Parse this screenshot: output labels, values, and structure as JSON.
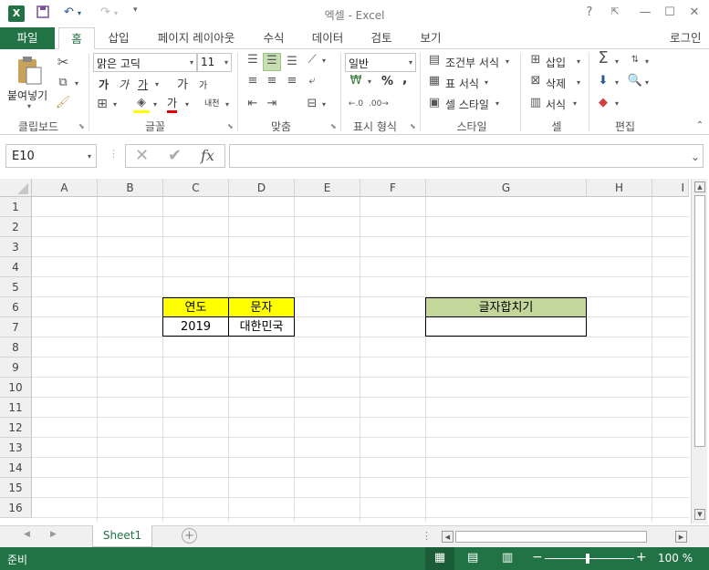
{
  "titlebar": {
    "title": "엑셀 - Excel",
    "app_icon": "excel-icon",
    "help": "?",
    "restore": "⊡",
    "minimize": "—",
    "maximize": "☐",
    "close": "✕"
  },
  "tabs": [
    {
      "label": "파일"
    },
    {
      "label": "홈"
    },
    {
      "label": "삽입"
    },
    {
      "label": "페이지 레이아웃"
    },
    {
      "label": "수식"
    },
    {
      "label": "데이터"
    },
    {
      "label": "검토"
    },
    {
      "label": "보기"
    }
  ],
  "signin": "로그인",
  "ribbon": {
    "clipboard": {
      "paste": "붙여넣기",
      "label": "클립보드"
    },
    "font": {
      "name": "맑은 고딕",
      "size": "11",
      "bold": "가",
      "italic": "가",
      "underline": "가",
      "grow": "가",
      "shrink": "가",
      "color_a": "가",
      "phonetic": "내천",
      "label": "글꼴"
    },
    "align": {
      "label": "맞춤"
    },
    "number": {
      "format": "일반",
      "percent": "%",
      "comma": ",",
      "label": "표시 형식"
    },
    "styles": {
      "conditional": "조건부 서식",
      "table": "표 서식",
      "cell": "셀 스타일",
      "label": "스타일"
    },
    "cells": {
      "insert": "삽입",
      "delete": "삭제",
      "format": "서식",
      "label": "셀"
    },
    "edit": {
      "label": "편집"
    }
  },
  "formula": {
    "namebox": "E10",
    "fx": "fx",
    "value": ""
  },
  "columns": [
    "A",
    "B",
    "C",
    "D",
    "E",
    "F",
    "G",
    "H",
    "I"
  ],
  "rows": [
    "1",
    "2",
    "3",
    "4",
    "5",
    "6",
    "7",
    "8",
    "9",
    "10",
    "11",
    "12",
    "13",
    "14",
    "15",
    "16"
  ],
  "cells": {
    "c6": "연도",
    "d6": "문자",
    "c7": "2019",
    "d7": "대한민국",
    "g6": "글자합치기",
    "g7": ""
  },
  "colors": {
    "accent": "#217346",
    "header_yellow": "#ffff00",
    "header_green": "#c4d79b"
  },
  "sheet": {
    "tab": "Sheet1"
  },
  "status": {
    "ready": "준비",
    "zoom": "100 %"
  }
}
